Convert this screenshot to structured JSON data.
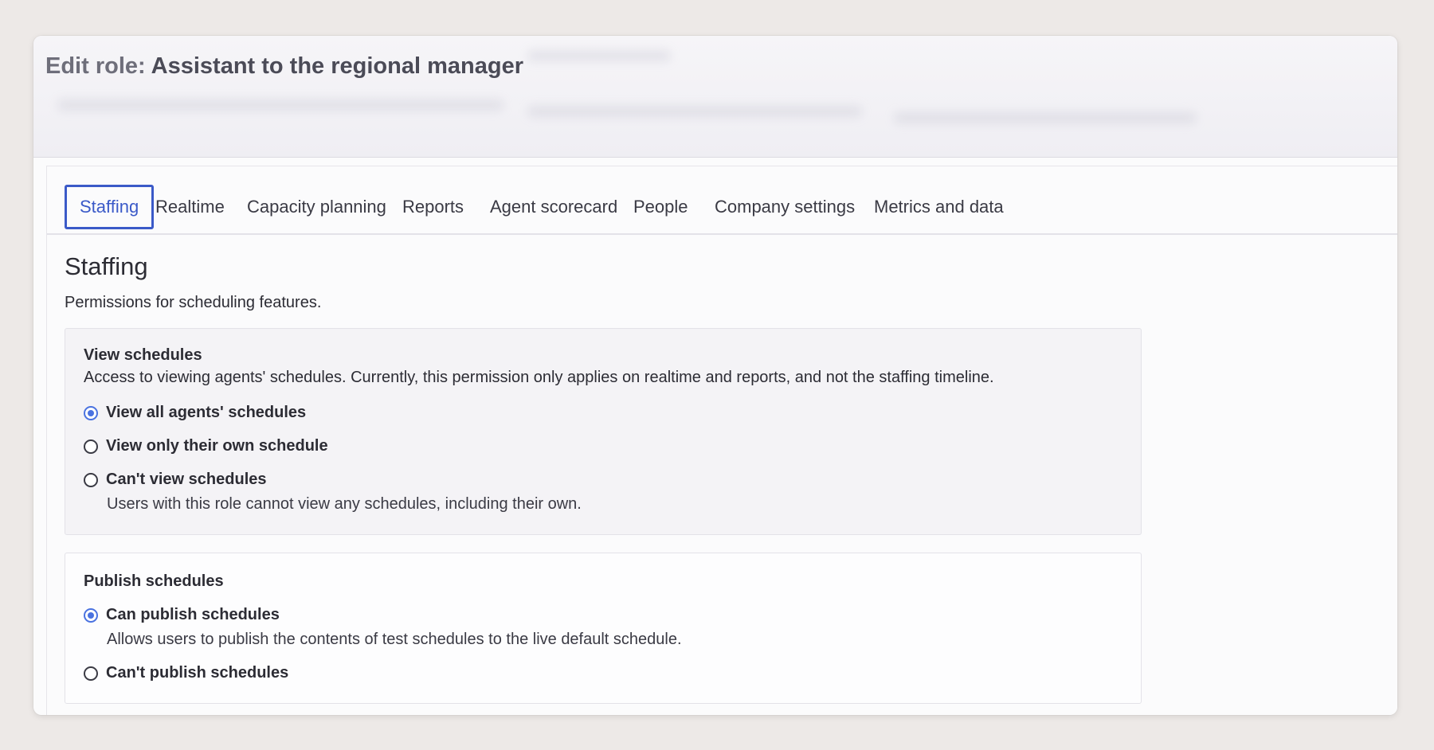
{
  "header": {
    "title_prefix": "Edit role:",
    "title_role": "Assistant to the regional manager"
  },
  "tabs": [
    {
      "label": "Staffing",
      "active": true
    },
    {
      "label": "Realtime",
      "active": false
    },
    {
      "label": "Capacity planning",
      "active": false
    },
    {
      "label": "Reports",
      "active": false
    },
    {
      "label": "Agent scorecard",
      "active": false
    },
    {
      "label": "People",
      "active": false
    },
    {
      "label": "Company settings",
      "active": false
    },
    {
      "label": "Metrics and data",
      "active": false
    }
  ],
  "section": {
    "title": "Staffing",
    "description": "Permissions for scheduling features."
  },
  "view_schedules": {
    "title": "View schedules",
    "description": "Access to viewing agents' schedules. Currently, this permission only applies on realtime and reports, and not the staffing timeline.",
    "options": [
      {
        "label": "View all agents' schedules",
        "checked": true,
        "help": ""
      },
      {
        "label": "View only their own schedule",
        "checked": false,
        "help": ""
      },
      {
        "label": "Can't view schedules",
        "checked": false,
        "help": "Users with this role cannot view any schedules, including their own."
      }
    ]
  },
  "publish_schedules": {
    "title": "Publish schedules",
    "options": [
      {
        "label": "Can publish schedules",
        "checked": true,
        "help": "Allows users to publish the contents of test schedules to the live default schedule."
      },
      {
        "label": "Can't publish schedules",
        "checked": false,
        "help": ""
      }
    ]
  },
  "colors": {
    "accent": "#3b5ac8",
    "radio_checked": "#4a72e0",
    "background": "#ede9e7",
    "panel": "#fbfbfc",
    "card_grey": "#f4f3f6"
  }
}
